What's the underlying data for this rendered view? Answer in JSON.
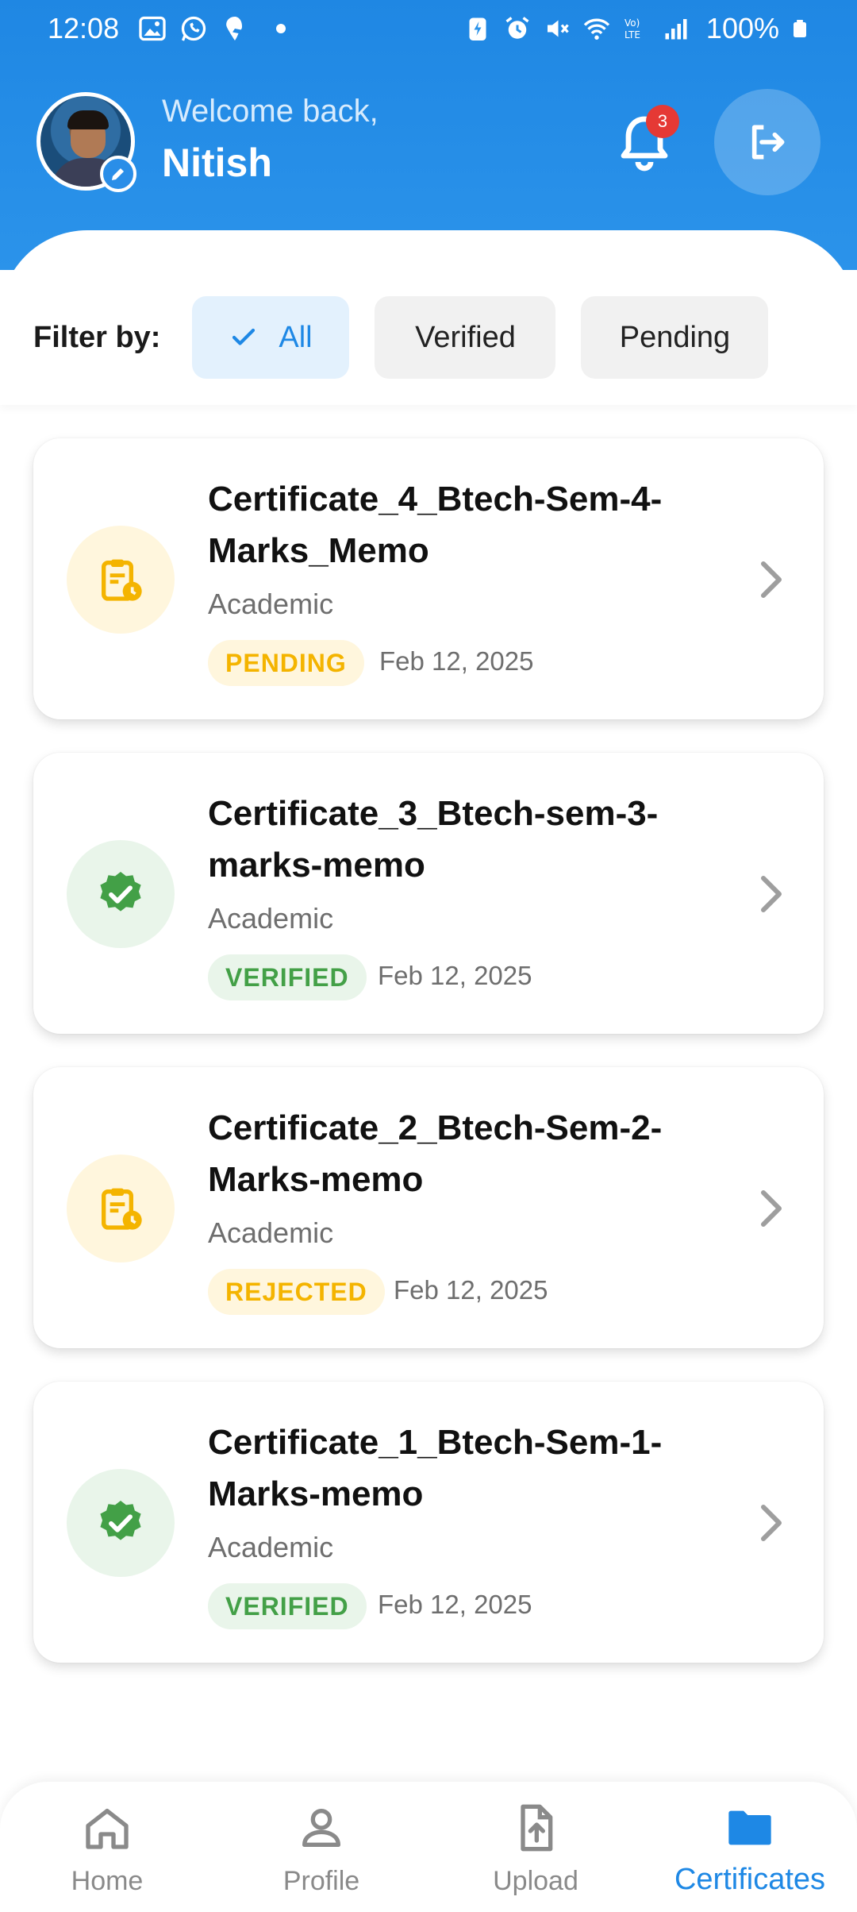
{
  "status_bar": {
    "time": "12:08",
    "battery": "100%"
  },
  "header": {
    "welcome": "Welcome back,",
    "user_name": "Nitish",
    "notification_count": "3"
  },
  "filter": {
    "label": "Filter by:",
    "chips": [
      "All",
      "Verified",
      "Pending"
    ],
    "selected": "All"
  },
  "certificates": [
    {
      "title": "Certificate_4_Btech-Sem-4-Marks_Memo",
      "category": "Academic",
      "status": "PENDING",
      "date": "Feb 12, 2025",
      "icon": "clipboard-clock-icon"
    },
    {
      "title": "Certificate_3_Btech-sem-3-marks-memo",
      "category": "Academic",
      "status": "VERIFIED",
      "date": "Feb 12, 2025",
      "icon": "verified-badge-icon"
    },
    {
      "title": "Certificate_2_Btech-Sem-2-Marks-memo",
      "category": "Academic",
      "status": "REJECTED",
      "date": "Feb 12, 2025",
      "icon": "clipboard-clock-icon"
    },
    {
      "title": "Certificate_1_Btech-Sem-1-Marks-memo",
      "category": "Academic",
      "status": "VERIFIED",
      "date": "Feb 12, 2025",
      "icon": "verified-badge-icon"
    }
  ],
  "nav": {
    "items": [
      "Home",
      "Profile",
      "Upload",
      "Certificates"
    ],
    "active": "Certificates"
  },
  "colors": {
    "primary": "#1e88e5",
    "pending": "#f4b400",
    "verified": "#43a047",
    "badge": "#e53935"
  }
}
